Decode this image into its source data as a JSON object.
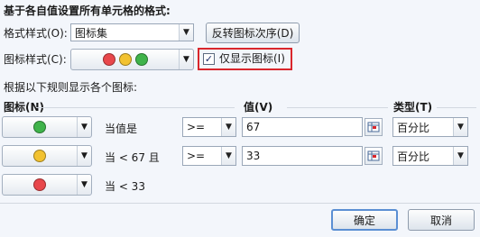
{
  "section_title": "基于各自值设置所有单元格的格式:",
  "format_style": {
    "label": "格式样式(O):",
    "value": "图标集"
  },
  "reverse_button": "反转图标次序(D)",
  "icon_style": {
    "label": "图标样式(C):",
    "icons": [
      "red-circle-icon",
      "yellow-circle-icon",
      "green-circle-icon"
    ]
  },
  "show_icon_only": {
    "label": "仅显示图标(I)",
    "checked": true,
    "check_mark": "✓"
  },
  "rules_heading": "根据以下规则显示各个图标:",
  "columns": {
    "icon": "图标(N)",
    "value": "值(V)",
    "type": "类型(T)"
  },
  "rules": [
    {
      "icon": "green-circle-icon",
      "condition": "当值是",
      "operator": ">=",
      "value": "67",
      "type": "百分比"
    },
    {
      "icon": "yellow-circle-icon",
      "condition": "当 < 67 且",
      "operator": ">=",
      "value": "33",
      "type": "百分比"
    },
    {
      "icon": "red-circle-icon",
      "condition": "当 < 33"
    }
  ],
  "ok_button": "确定",
  "cancel_button": "取消",
  "colors": {
    "red": "#e8474b",
    "yellow": "#f2c230",
    "green": "#3fb34a",
    "highlight_border": "#d9262c"
  }
}
